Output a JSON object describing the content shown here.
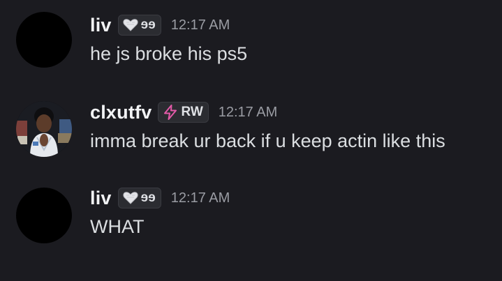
{
  "messages": [
    {
      "author": "liv",
      "tag": {
        "icon": "heart-icon",
        "text": "ɘɘ"
      },
      "time": "12:17 AM",
      "text": "he js broke his ps5"
    },
    {
      "author": "clxutfv",
      "tag": {
        "icon": "lightning-icon",
        "text": "RW"
      },
      "time": "12:17 AM",
      "text": "imma break ur back if u keep actin like this"
    },
    {
      "author": "liv",
      "tag": {
        "icon": "heart-icon",
        "text": "ɘɘ"
      },
      "time": "12:17 AM",
      "text": "WHAT"
    }
  ],
  "colors": {
    "background": "#1b1b20",
    "username": "#f2f3f5",
    "message_text": "#dbdee1",
    "timestamp": "#9a9ca3",
    "tag_bg": "#2b2c31",
    "lightning_accent": "#e35aa8"
  }
}
